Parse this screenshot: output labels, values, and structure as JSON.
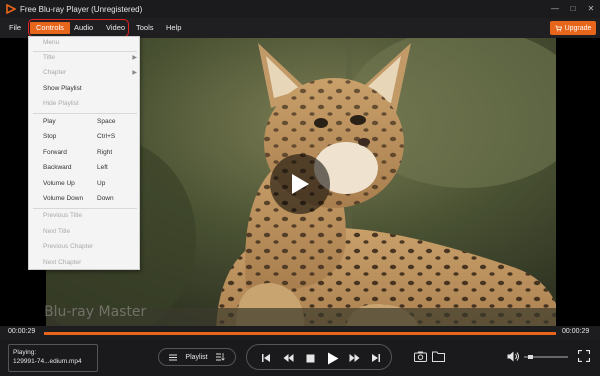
{
  "window": {
    "title": "Free Blu-ray Player (Unregistered)",
    "controls": [
      "—",
      "□",
      "✕"
    ]
  },
  "menubar": {
    "file": "File",
    "controls": "Controls",
    "audio": "Audio",
    "video": "Video",
    "tools": "Tools",
    "help": "Help",
    "upgrade": "Upgrade"
  },
  "dropdown": {
    "menu": "Menu",
    "title": "Title",
    "chapter": "Chapter",
    "show_playlist": "Show Playlist",
    "hide_playlist": "Hide Playlist",
    "play": "Play",
    "play_key": "Space",
    "stop": "Stop",
    "stop_key": "Ctrl+S",
    "forward": "Forward",
    "forward_key": "Right",
    "backward": "Backward",
    "backward_key": "Left",
    "volume_up": "Volume Up",
    "volume_up_key": "Up",
    "volume_down": "Volume Down",
    "volume_down_key": "Down",
    "previous_title": "Previous Title",
    "next_title": "Next Title",
    "previous_chapter": "Previous Chapter",
    "next_chapter": "Next Chapter"
  },
  "video": {
    "watermark": "Blu-ray Master"
  },
  "progress": {
    "current": "00:00:29",
    "total": "00:00:29",
    "fraction": 1.0
  },
  "bottom": {
    "playing_label": "Playing:",
    "playing_file": "129991-74...edium.mp4",
    "playlist_label": "Playlist",
    "volume_fraction": 0.1
  },
  "colors": {
    "accent": "#e8651c",
    "highlight": "#e22121"
  }
}
